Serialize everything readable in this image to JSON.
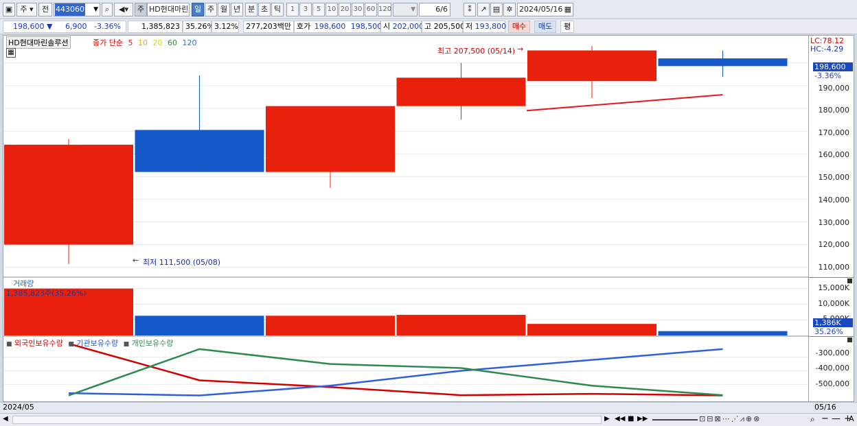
{
  "toolbar": {
    "period_select": "주",
    "prefix_btn": "전",
    "stock_code": "443060",
    "stock_kind": "주",
    "stock_name": "HD현대마린",
    "periods": [
      "일",
      "주",
      "월",
      "년",
      "분",
      "초",
      "틱"
    ],
    "active_period": "일",
    "intervals": [
      "1",
      "3",
      "5",
      "10",
      "20",
      "30",
      "60",
      "120"
    ],
    "page_count": "6/6",
    "date": "2024/05/16"
  },
  "quote": {
    "price": "198,600",
    "change_arrow": "▼",
    "change": "6,900",
    "change_pct": "-3.36%",
    "volume": "1,385,823",
    "turnover_pct": "35.26%",
    "ratio": "3.12%",
    "amount": "277,203백만",
    "bid_label": "호가",
    "ask": "198,600",
    "bid": "198,500",
    "open_label": "시",
    "open": "202,000",
    "high_label": "고",
    "high": "205,500",
    "low_label": "저",
    "low": "193,800",
    "buy_label": "매수",
    "sell_label": "매도",
    "avg_label": "평"
  },
  "price_panel": {
    "stock_label": "HD현대마린솔루션",
    "ma_title": "종가 단순",
    "ma_periods": [
      "5",
      "10",
      "20",
      "60",
      "120"
    ],
    "ma_colors": [
      "#e8141e",
      "#f2a900",
      "#d8d800",
      "#2b8a2b",
      "#1a7ac8"
    ],
    "high_annotation": "최고 207,500 (05/14)",
    "low_annotation": "최저 111,500 (05/08)",
    "lc": "LC:78.12",
    "hc": "HC:-4.29",
    "current_price": "198,600",
    "current_pct": "-3.36%",
    "ticks": [
      "190,000",
      "180,000",
      "170,000",
      "160,000",
      "150,000",
      "140,000",
      "130,000",
      "120,000",
      "110,000"
    ]
  },
  "volume_panel": {
    "title": "거래량",
    "value": "1,385,823주(35.26%)",
    "ticks": [
      "15,000K",
      "10,000K",
      "5,000K"
    ],
    "current": "1,386K",
    "current_pct": "35.26%"
  },
  "holding_panel": {
    "legend": [
      {
        "name": "외국인보유수량",
        "color": "#d40000"
      },
      {
        "name": "기관보유수량",
        "color": "#1a5cd0"
      },
      {
        "name": "개인보유수량",
        "color": "#2d8a4e"
      }
    ],
    "ticks": [
      "-300,000",
      "-400,000",
      "-500,000"
    ]
  },
  "date_axis": {
    "start": "2024/05",
    "end": "05/16"
  },
  "chart_data": {
    "type": "candlestick",
    "candles": [
      {
        "open": 120000,
        "close": 164000,
        "high": 166500,
        "low": 111500,
        "color": "red"
      },
      {
        "open": 170500,
        "close": 152000,
        "high": 194500,
        "low": 152000,
        "color": "blue"
      },
      {
        "open": 152000,
        "close": 181000,
        "high": 181000,
        "low": 145000,
        "color": "red"
      },
      {
        "open": 181000,
        "close": 193500,
        "high": 200000,
        "low": 175000,
        "color": "red"
      },
      {
        "open": 192000,
        "close": 205500,
        "high": 207500,
        "low": 184500,
        "color": "red"
      },
      {
        "open": 202000,
        "close": 198600,
        "high": 205500,
        "low": 193800,
        "color": "blue"
      }
    ],
    "ma5": [
      179000,
      186000
    ],
    "ylim": [
      106000,
      212000
    ],
    "volume_k": [
      15000,
      6300,
      6300,
      6600,
      3700,
      1386
    ],
    "volume_ylim": [
      0,
      18000
    ],
    "holding": {
      "foreign": [
        -200000,
        -470000,
        -520000,
        -580000,
        -570000,
        -582000
      ],
      "institution": [
        -565000,
        -582000,
        -510000,
        -400000,
        -320000,
        -240000
      ],
      "individual": [
        -582000,
        -240000,
        -350000,
        -380000,
        -510000,
        -580000
      ],
      "ylim": [
        -610000,
        -180000
      ]
    }
  }
}
